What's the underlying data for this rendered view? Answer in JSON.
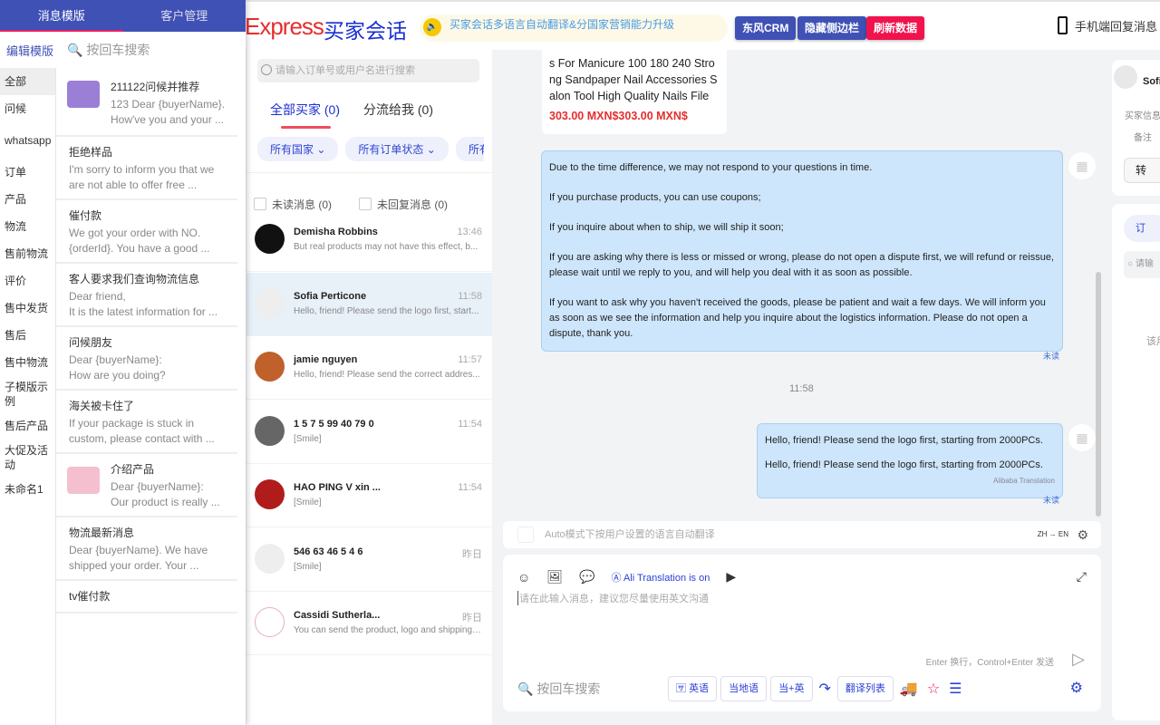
{
  "header": {
    "logo": "Express",
    "title": "买家会话",
    "notice": "买家会话多语言自动翻译&分国家营销能力升级",
    "buttons": [
      {
        "label": "东风CRM",
        "color": "#3f51b5"
      },
      {
        "label": "隐藏侧边栏",
        "color": "#3f51b5"
      },
      {
        "label": "刷新数据",
        "color": "#f0134d"
      }
    ],
    "phone_label": "手机端回复消息"
  },
  "left_panel": {
    "tabs": [
      "消息模版",
      "客户管理"
    ],
    "edit_label": "编辑模版",
    "search_placeholder": "按回车搜索",
    "categories": [
      "全部",
      "问候",
      "whatsapp",
      "订单",
      "产品",
      "物流",
      "售前物流",
      "评价",
      "售中发货",
      "售后",
      "售中物流",
      "子模版示例",
      "售后产品",
      "大促及活动",
      "未命名1"
    ],
    "templates": [
      {
        "title": "211122问候并推荐",
        "desc": "123 Dear {buyerName}.\nHow've you and your ..."
      },
      {
        "title": "拒绝样品",
        "desc": "I'm sorry to inform you that we\nare not able to offer free ..."
      },
      {
        "title": "催付款",
        "desc": "We got your order with NO.\n{orderId}. You have a good ..."
      },
      {
        "title": "客人要求我们查询物流信息",
        "desc": "Dear friend,\nIt is the latest information for ..."
      },
      {
        "title": "问候朋友",
        "desc": "Dear {buyerName}:\nHow are you doing?"
      },
      {
        "title": "海关被卡住了",
        "desc": "If your package is stuck in\ncustom, please contact with ..."
      },
      {
        "title": "介绍产品",
        "desc": "Dear {buyerName}:\nOur product is really ..."
      },
      {
        "title": "物流最新消息",
        "desc": "Dear {buyerName}. We have\nshipped your order. Your ..."
      },
      {
        "title": "tv催付款",
        "desc": ""
      }
    ]
  },
  "conversations": {
    "search_placeholder": "请输入订单号或用户名进行搜索",
    "tabs": [
      "全部买家 (0)",
      "分流给我 (0)"
    ],
    "filters": [
      "所有国家",
      "所有订单状态",
      "所有星"
    ],
    "checks": [
      "未读消息 (0)",
      "未回复消息 (0)"
    ],
    "items": [
      {
        "name": "Demisha Robbins",
        "time": "13:46",
        "preview": "But real products may not have this effect, b...",
        "avatar": "#111"
      },
      {
        "name": "Sofia Perticone",
        "time": "11:58",
        "preview": "Hello, friend! Please send the logo first, start...",
        "avatar": "#eee",
        "selected": true
      },
      {
        "name": "jamie nguyen",
        "time": "11:57",
        "preview": "Hello, friend! Please send the correct addres...",
        "avatar": "#c0602a"
      },
      {
        "name": "1 5 7 5 99 40 79 0",
        "time": "11:54",
        "preview": "[Smile]",
        "avatar": "#666"
      },
      {
        "name": "HAO PING V xin ...",
        "time": "11:54",
        "preview": "[Smile]",
        "avatar": "#b01c1c"
      },
      {
        "name": "546 63 46 5 4 6",
        "time": "昨日",
        "preview": "[Smile]",
        "avatar": "#eee"
      },
      {
        "name": "Cassidi Sutherla...",
        "time": "昨日",
        "preview": "You can send the product, logo and shipping ...",
        "avatar": "#fff"
      }
    ]
  },
  "chat": {
    "product_text": "s For Manicure 100 180 240 Stro ng Sandpaper Nail Accessories S alon Tool High Quality Nails File",
    "product_price": "303.00 MXN$303.00 MXN$",
    "msg1": [
      "Due to the time difference, we may not respond to your questions in time.",
      "If you purchase products, you can use coupons;",
      "If you inquire about when to ship, we will ship it soon;",
      "If you are asking why there is less or missed or wrong, please do not open a dispute first, we will refund or reissue, please wait until we reply to you, and will help you deal with it as soon as possible.",
      "If you want to ask why you haven't received the goods, please be patient and wait a few days. We will inform you as soon as we see the information and help you inquire about the logistics information. Please do not open a dispute, thank you."
    ],
    "unread": "未读",
    "timestamp": "11:58",
    "msg2": [
      "Hello, friend! Please send the logo first, starting from 2000PCs.",
      "Hello, friend! Please send the logo first, starting from 2000PCs."
    ],
    "msg2_source": "Alibaba Translation"
  },
  "auto_bar": {
    "text": "Auto模式下按用户设置的语言自动翻译",
    "from": "ZH",
    "to": "EN"
  },
  "composer": {
    "ali_translation": "Ali Translation is on",
    "placeholder": "请在此输入消息，建议您尽量使用英文沟通",
    "hint": "Enter 换行，Control+Enter 发送",
    "search_placeholder": "按回车搜索",
    "buttons": [
      "英语",
      "当地语",
      "当+英",
      "翻译列表"
    ]
  },
  "right_panel": {
    "name": "Sofi",
    "buyer_info": "买家信息",
    "note": "备注",
    "transfer": "转",
    "order_tab": "订",
    "search": "请输",
    "empty": "该用"
  }
}
